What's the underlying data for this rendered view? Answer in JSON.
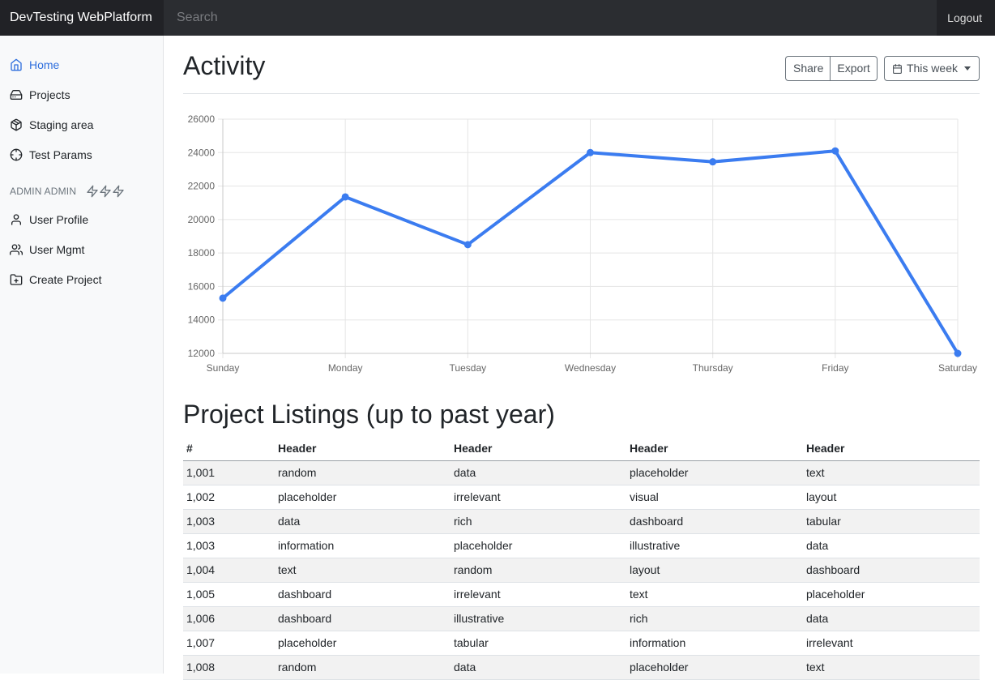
{
  "app": {
    "brand": "DevTesting WebPlatform",
    "search_placeholder": "Search",
    "logout_label": "Logout"
  },
  "sidebar": {
    "items": [
      {
        "label": "Home",
        "icon": "home-icon",
        "active": true
      },
      {
        "label": "Projects",
        "icon": "hard-drive-icon",
        "active": false
      },
      {
        "label": "Staging area",
        "icon": "package-icon",
        "active": false
      },
      {
        "label": "Test Params",
        "icon": "crosshair-icon",
        "active": false
      }
    ],
    "admin_heading": "ADMIN ADMIN",
    "admin_icons": [
      "zap-icon",
      "zap-icon",
      "zap-icon"
    ],
    "admin_items": [
      {
        "label": "User Profile",
        "icon": "user-icon"
      },
      {
        "label": "User Mgmt",
        "icon": "users-icon"
      },
      {
        "label": "Create Project",
        "icon": "folder-plus-icon"
      }
    ]
  },
  "header": {
    "title": "Activity",
    "share_label": "Share",
    "export_label": "Export",
    "range_label": "This week"
  },
  "chart_data": {
    "type": "line",
    "categories": [
      "Sunday",
      "Monday",
      "Tuesday",
      "Wednesday",
      "Thursday",
      "Friday",
      "Saturday"
    ],
    "series": [
      {
        "values": [
          15300,
          21350,
          18500,
          24000,
          23450,
          24100,
          12000
        ]
      }
    ],
    "ylim": [
      12000,
      26000
    ],
    "yticks": [
      26000,
      24000,
      22000,
      20000,
      18000,
      16000,
      14000,
      12000
    ],
    "grid": true,
    "color": "#3b7cf0"
  },
  "listings": {
    "title": "Project Listings (up to past year)",
    "columns": [
      "#",
      "Header",
      "Header",
      "Header",
      "Header"
    ],
    "rows": [
      [
        "1,001",
        "random",
        "data",
        "placeholder",
        "text"
      ],
      [
        "1,002",
        "placeholder",
        "irrelevant",
        "visual",
        "layout"
      ],
      [
        "1,003",
        "data",
        "rich",
        "dashboard",
        "tabular"
      ],
      [
        "1,003",
        "information",
        "placeholder",
        "illustrative",
        "data"
      ],
      [
        "1,004",
        "text",
        "random",
        "layout",
        "dashboard"
      ],
      [
        "1,005",
        "dashboard",
        "irrelevant",
        "text",
        "placeholder"
      ],
      [
        "1,006",
        "dashboard",
        "illustrative",
        "rich",
        "data"
      ],
      [
        "1,007",
        "placeholder",
        "tabular",
        "information",
        "irrelevant"
      ],
      [
        "1,008",
        "random",
        "data",
        "placeholder",
        "text"
      ]
    ]
  }
}
